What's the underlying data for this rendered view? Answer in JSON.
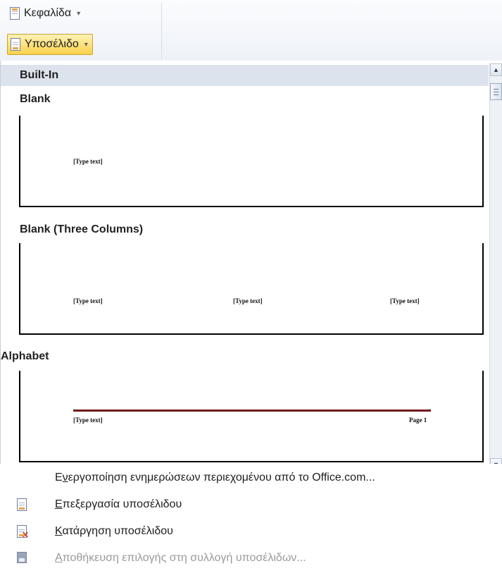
{
  "ribbon": {
    "header_label": "Κεφαλίδα",
    "footer_label": "Υποσέλιδο",
    "caret": "▾"
  },
  "gallery": {
    "section_title": "Built-In",
    "items": [
      {
        "label": "Blank",
        "placeholders": [
          "[Type text]"
        ]
      },
      {
        "label": "Blank (Three Columns)",
        "placeholders": [
          "[Type text]",
          "[Type text]",
          "[Type text]"
        ]
      },
      {
        "label": "Alphabet",
        "placeholders": [
          "[Type text]"
        ],
        "page_text": "Page 1",
        "rule_color": "#6e1a1a"
      }
    ]
  },
  "scrollbar": {
    "up": "▲",
    "down": "▼"
  },
  "menu": {
    "items": [
      {
        "pre": "Ε",
        "ul": "ν",
        "post": "εργοποίηση ενημερώσεων περιεχομένου από το Office.com...",
        "icon": "none",
        "enabled": true
      },
      {
        "pre": "",
        "ul": "Ε",
        "post": "πεξεργασία υποσέλιδου",
        "icon": "footer-doc-icon",
        "enabled": true
      },
      {
        "pre": "",
        "ul": "Κ",
        "post": "ατάργηση υποσέλιδου",
        "icon": "remove-footer-icon",
        "enabled": true
      },
      {
        "pre": "",
        "ul": "Α",
        "post": "ποθήκευση επιλογής στη συλλογή υποσέλιδων...",
        "icon": "save-selection-icon",
        "enabled": false
      }
    ]
  },
  "colors": {
    "footer_button_bg": "#fbd04a",
    "section_header_bg": "#dde3ec",
    "remove_x": "#d4332a"
  }
}
